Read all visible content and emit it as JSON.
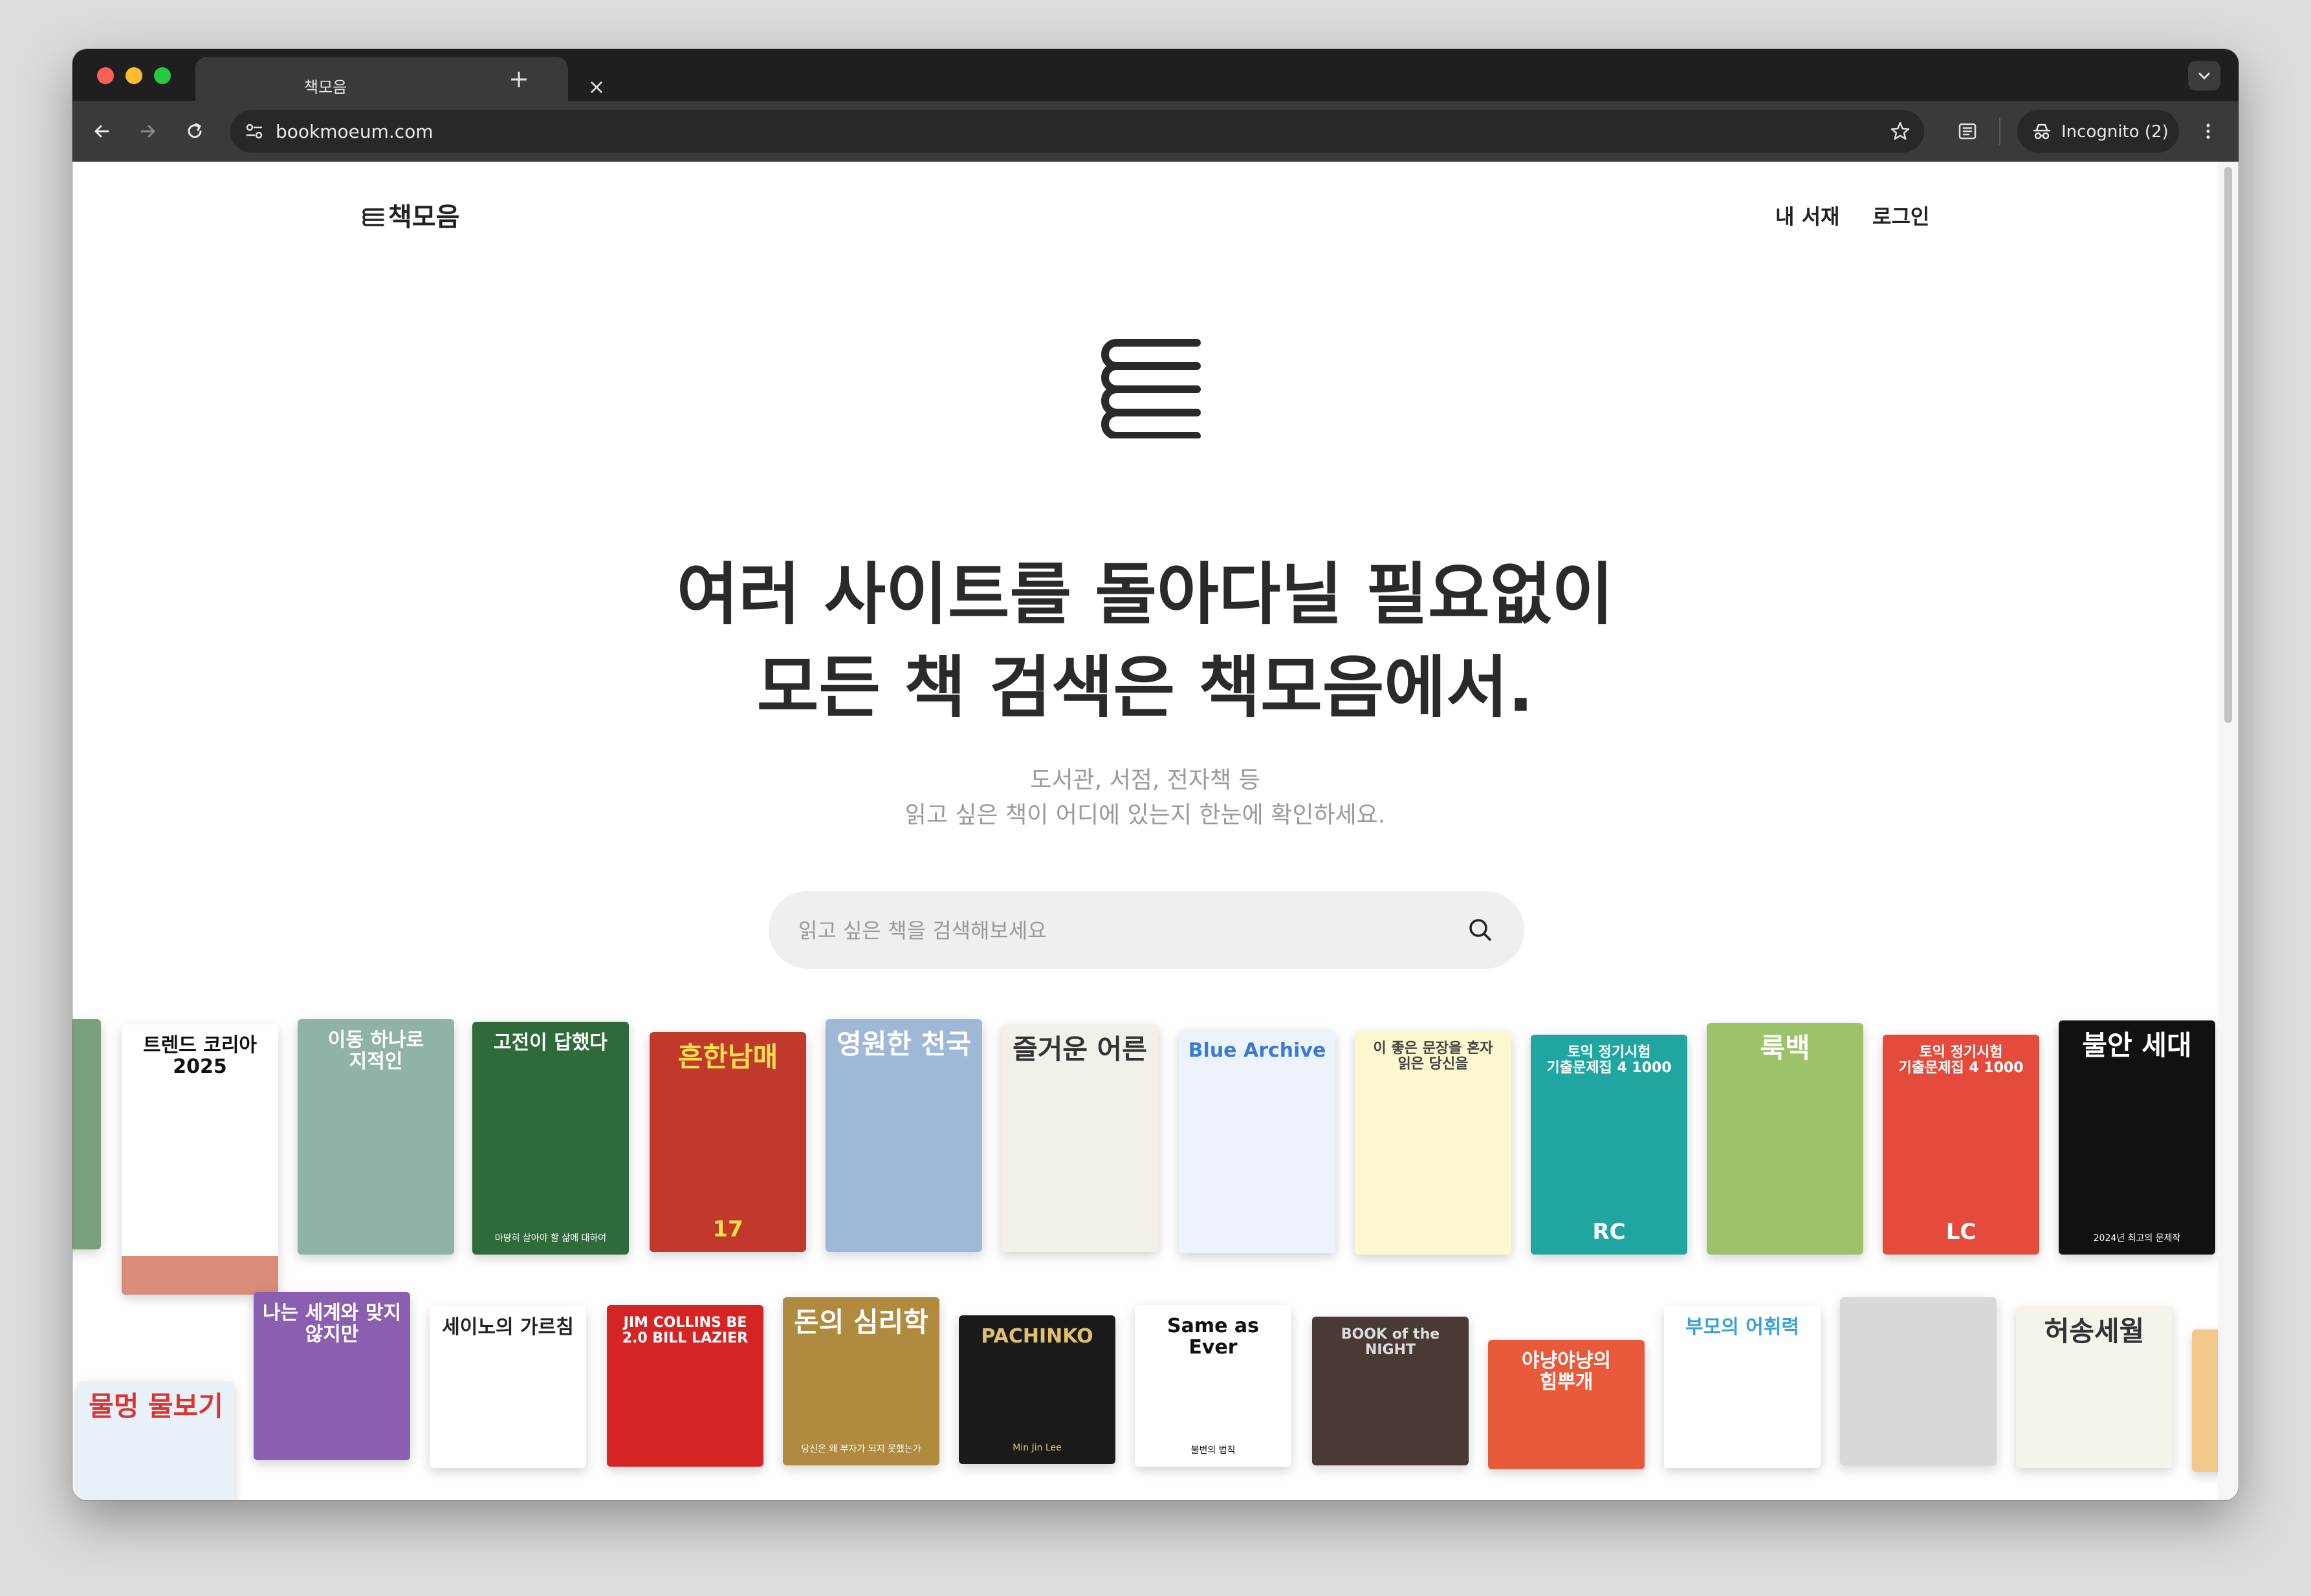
{
  "browser": {
    "tab_title": "책모음",
    "tab_close": "×",
    "new_tab": "+",
    "url": "bookmoeum.com",
    "incognito_label": "Incognito (2)"
  },
  "site": {
    "logo_text": "책모음",
    "nav": {
      "library": "내 서재",
      "login": "로그인"
    },
    "headline_line1": "여러 사이트를 돌아다닐 필요없이",
    "headline_line2": "모든 책 검색은 책모음에서.",
    "sub_line1": "도서관, 서점, 전자책 등",
    "sub_line2": "읽고 싶은 책이 어디에 있는지 한눈에 확인하세요.",
    "search_placeholder": "읽고 싶은 책을 검색해보세요"
  },
  "colors": {
    "chrome_dark": "#1f1f1f",
    "toolbar": "#3a3a3c",
    "search_bg": "#efefef",
    "headline": "#2a2a2a"
  },
  "books_row1": [
    {
      "title": "",
      "sub": "",
      "bg": "#7aa07a",
      "fg": "#fff"
    },
    {
      "title": "트렌드 코리아 2025",
      "sub": "",
      "bg": "#ffffff",
      "fg": "#111",
      "accent": "#d98c7a"
    },
    {
      "title": "이동 하나로 지적인",
      "sub": "",
      "bg": "#8fb3a6",
      "fg": "#fff"
    },
    {
      "title": "고전이 답했다",
      "sub": "마땅히 살아야 할 삶에 대하여",
      "bg": "#2f6a3a",
      "fg": "#fff"
    },
    {
      "title": "흔한남매",
      "sub": "17",
      "bg": "#c0392b",
      "fg": "#ffe14d"
    },
    {
      "title": "영원한 천국",
      "sub": "",
      "bg": "#9fb8d8",
      "fg": "#fff"
    },
    {
      "title": "즐거운 어른",
      "sub": "",
      "bg": "#f2f0e8",
      "fg": "#333"
    },
    {
      "title": "Blue Archive",
      "sub": "",
      "bg": "#eef3fb",
      "fg": "#3a7bd5"
    },
    {
      "title": "이 좋은 문장을 혼자 읽은 당신을",
      "sub": "",
      "bg": "#fbf7cf",
      "fg": "#444"
    },
    {
      "title": "토익 정기시험 기출문제집 4 1000",
      "sub": "RC",
      "bg": "#1fa6a0",
      "fg": "#fff"
    },
    {
      "title": "룩백",
      "sub": "",
      "bg": "#9cc36a",
      "fg": "#fff"
    },
    {
      "title": "토익 정기시험 기출문제집 4 1000",
      "sub": "LC",
      "bg": "#e54b3c",
      "fg": "#fff"
    },
    {
      "title": "불안 세대",
      "sub": "2024년 최고의 문제작",
      "bg": "#111111",
      "fg": "#fff"
    }
  ],
  "books_row2": [
    {
      "title": "물멍 물보기",
      "sub": "",
      "bg": "#e8f0f8",
      "fg": "#d33"
    },
    {
      "title": "나는 세계와 맞지 않지만",
      "sub": "",
      "bg": "#8a5fb0",
      "fg": "#fff"
    },
    {
      "title": "세이노의 가르침",
      "sub": "",
      "bg": "#ffffff",
      "fg": "#222"
    },
    {
      "title": "JIM COLLINS BE 2.0 BILL LAZIER",
      "sub": "",
      "bg": "#d42424",
      "fg": "#fff"
    },
    {
      "title": "돈의 심리학",
      "sub": "당신은 왜 부자가 되지 못했는가",
      "bg": "#b08a3e",
      "fg": "#fff"
    },
    {
      "title": "PACHINKO",
      "sub": "Min Jin Lee",
      "bg": "#1a1a1a",
      "fg": "#e0c070"
    },
    {
      "title": "Same as Ever",
      "sub": "불변의 법칙",
      "bg": "#ffffff",
      "fg": "#111"
    },
    {
      "title": "BOOK of the NIGHT",
      "sub": "",
      "bg": "#4a3a36",
      "fg": "#ddd"
    },
    {
      "title": "야냥야냥의 힘뿌개",
      "sub": "",
      "bg": "#e85a3a",
      "fg": "#fff"
    },
    {
      "title": "부모의 어휘력",
      "sub": "",
      "bg": "#ffffff",
      "fg": "#3aa0d8"
    },
    {
      "title": "",
      "sub": "",
      "bg": "#d8d8d8",
      "fg": "#fff"
    },
    {
      "title": "허송세월",
      "sub": "",
      "bg": "#f6f3ea",
      "fg": "#333"
    },
    {
      "title": "",
      "sub": "",
      "bg": "#f3c78a",
      "fg": "#fff"
    }
  ]
}
